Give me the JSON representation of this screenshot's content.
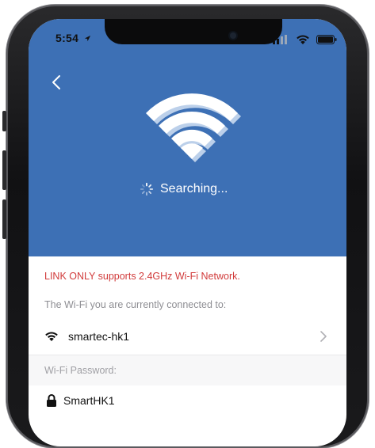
{
  "status_bar": {
    "time": "5:54",
    "icons": [
      "location-arrow-icon",
      "cellular-signal-icon",
      "wifi-icon",
      "battery-icon"
    ]
  },
  "header": {
    "back_icon": "chevron-left-icon",
    "status_text": "Searching..."
  },
  "content": {
    "warning": "LINK ONLY supports 2.4GHz Wi-Fi Network.",
    "connected_hint": "The Wi-Fi you are currently connected to:",
    "network_name": "smartec-hk1",
    "password_label": "Wi-Fi Password:",
    "password_value": "SmartHK1"
  },
  "colors": {
    "accent": "#3d70b5",
    "warning": "#d13b3b",
    "muted": "#8e8e93"
  }
}
